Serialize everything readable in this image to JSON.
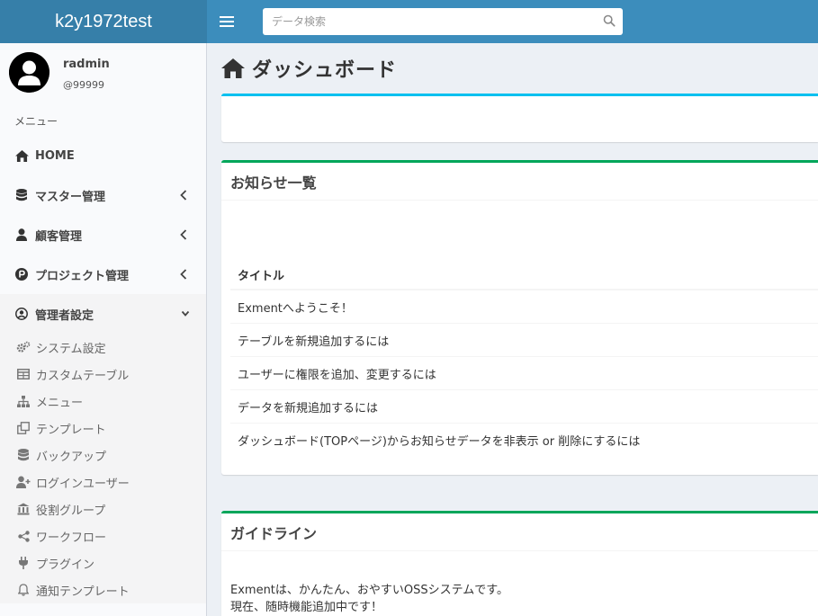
{
  "header": {
    "app_title": "k2y1972test",
    "menu_toggle_icon": "hamburger-icon",
    "search": {
      "placeholder": "データ検索",
      "value": "",
      "icon": "search-icon"
    }
  },
  "sidebar": {
    "user": {
      "name": "radmin",
      "id": "@99999",
      "avatar_icon": "user-avatar-icon"
    },
    "menu_header": "メニュー",
    "items": [
      {
        "label": "HOME",
        "icon": "home-icon"
      },
      {
        "label": "マスター管理",
        "icon": "database-icon",
        "expandable": true,
        "expanded": false
      },
      {
        "label": "顧客管理",
        "icon": "user-icon",
        "expandable": true,
        "expanded": false
      },
      {
        "label": "プロジェクト管理",
        "icon": "p-circle-icon",
        "expandable": true,
        "expanded": false
      },
      {
        "label": "管理者設定",
        "icon": "user-circle-icon",
        "expandable": true,
        "expanded": true
      }
    ],
    "admin_sub": [
      {
        "label": "システム設定",
        "icon": "cogs-icon"
      },
      {
        "label": "カスタムテーブル",
        "icon": "table-icon"
      },
      {
        "label": "メニュー",
        "icon": "sitemap-icon"
      },
      {
        "label": "テンプレート",
        "icon": "clone-icon"
      },
      {
        "label": "バックアップ",
        "icon": "database-icon"
      },
      {
        "label": "ログインユーザー",
        "icon": "user-plus-icon"
      },
      {
        "label": "役割グループ",
        "icon": "bank-icon"
      },
      {
        "label": "ワークフロー",
        "icon": "share-icon"
      },
      {
        "label": "プラグイン",
        "icon": "plug-icon"
      },
      {
        "label": "通知テンプレート",
        "icon": "bell-icon"
      }
    ]
  },
  "main": {
    "page_title": "ダッシュボード",
    "page_icon": "home-icon",
    "news": {
      "title": "お知らせ一覧",
      "column_header": "タイトル",
      "rows": [
        "Exmentへようこそ！",
        "テーブルを新規追加するには",
        "ユーザーに権限を追加、変更するには",
        "データを新規追加するには",
        "ダッシュボード(TOPページ)からお知らせデータを非表示 or 削除にするには"
      ]
    },
    "guide": {
      "title": "ガイドライン",
      "line1": "Exmentは、かんたん、おやすいOSSシステムです。",
      "line2": "現在、随時機能追加中です！"
    }
  },
  "colors": {
    "header_bg": "#3c8dbc",
    "logo_bg": "#367fa9",
    "box_top_cyan": "#00c0ef",
    "box_top_green": "#00a65a",
    "content_bg": "#ecf0f5"
  }
}
